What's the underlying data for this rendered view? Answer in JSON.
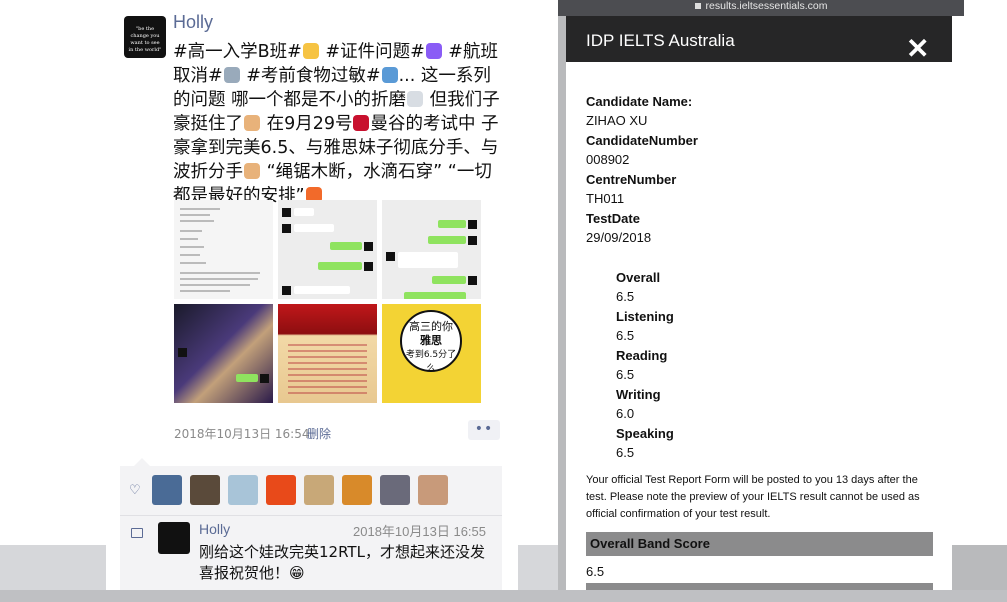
{
  "post": {
    "author": "Holly",
    "avatar_caption": "\"be the change you want to see in the world\"",
    "text_html": "#高一入学B班#<span class=\"emo\" style=\"background:#f6c343\"></span> #证件问题#<span class=\"emo\" style=\"background:#8a5cf6\"></span> #航班取消#<span class=\"emo\" style=\"background:#9ab\"></span> #考前食物过敏#<span class=\"emo\" style=\"background:#5a9ad6\"></span>... 这一系列的问题 哪一个都是不小的折磨<span class=\"emo\" style=\"background:#d8dde3\"></span> 但我们子豪挺住了<span class=\"emo\" style=\"background:#e8b27a\"></span> 在9月29号<span class=\"emo\" style=\"background:#c8102e\"></span>曼谷的考试中 子豪拿到完美6.5、与雅思妹子彻底分手、与波折分手<span class=\"emo\" style=\"background:#e8b27a\"></span> “绳锯木断，水滴石穿” “一切都是最好的安排”<span class=\"emo\" style=\"background:#f26a2a\"></span>",
    "time": "2018年10月13日 16:54",
    "delete_label": "删除",
    "more_label": "••",
    "circle_text": [
      "高三的你",
      "雅思",
      "考到6.5分了么"
    ],
    "comment": {
      "author": "Holly",
      "time": "2018年10月13日 16:55",
      "text": "刚给这个娃改完英12RTL，才想起来还没发喜报祝贺他！😁"
    }
  },
  "likes_colors": [
    "#4a6b96",
    "#5a4a3a",
    "#a8c4d8",
    "#e84a1a",
    "#c8a878",
    "#d88a2a",
    "#6a6a7a",
    "#c89a7a"
  ],
  "browser": {
    "url": "results.ieltsessentials.com"
  },
  "dialog": {
    "title": "IDP IELTS Australia",
    "close": "✕",
    "candidate_name_label": "Candidate Name:",
    "candidate_name": "ZIHAO XU",
    "candidate_number_label": "CandidateNumber",
    "candidate_number": "008902",
    "centre_number_label": "CentreNumber",
    "centre_number": "TH011",
    "test_date_label": "TestDate",
    "test_date": "29/09/2018",
    "scores": [
      {
        "label": "Overall",
        "value": "6.5"
      },
      {
        "label": "Listening",
        "value": "6.5"
      },
      {
        "label": "Reading",
        "value": "6.5"
      },
      {
        "label": "Writing",
        "value": "6.0"
      },
      {
        "label": "Speaking",
        "value": "6.5"
      }
    ],
    "note": "Your official Test Report Form will be posted to you 13 days after the test. Please note the preview of your IELTS result cannot be used as official confirmation of your test result.",
    "overall_band_label": "Overall Band Score",
    "overall_band_value": "6.5"
  }
}
